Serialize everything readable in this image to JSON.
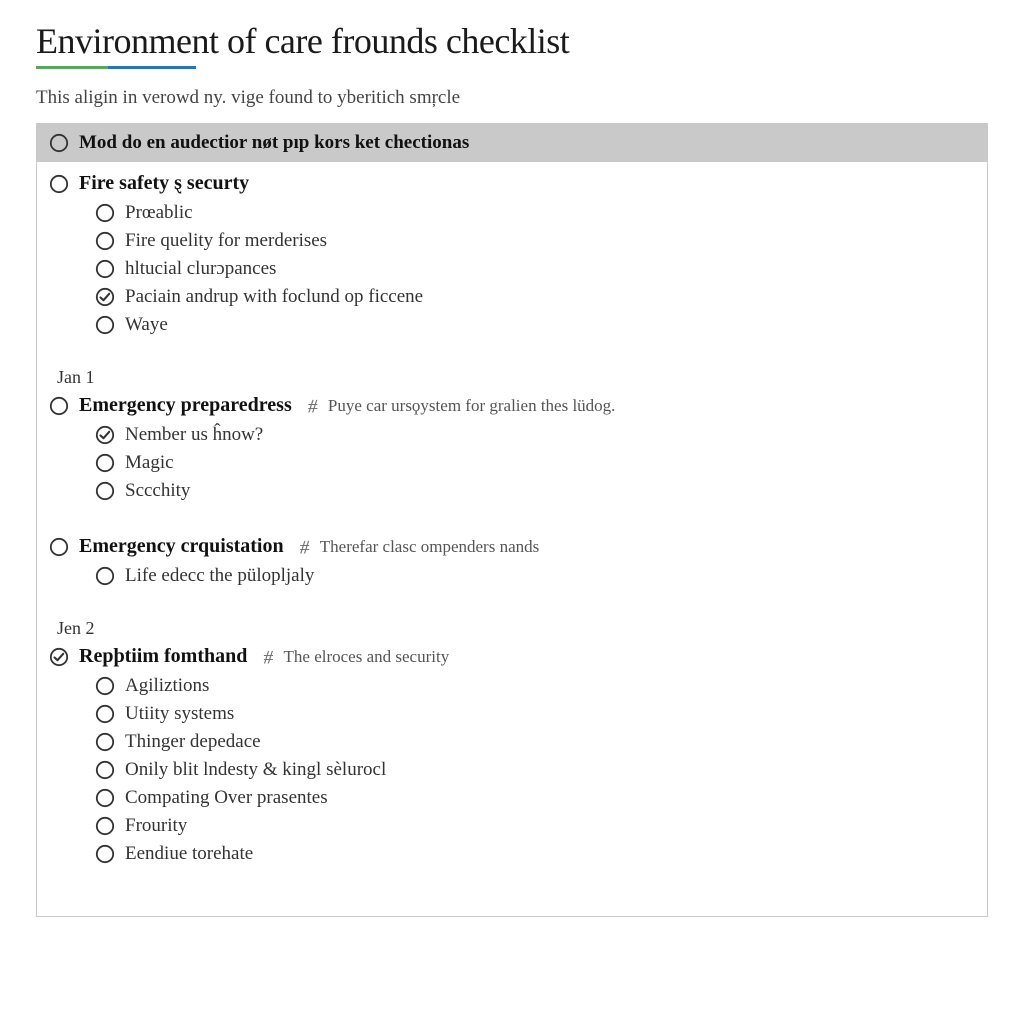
{
  "header": {
    "title": "Environment of care frounds checklist",
    "subtitle": "This aligin in verowd ny. vige found to yberitich smŗcle"
  },
  "panel": {
    "header_label": "Mod do en audectior nøt pıp kors ket chectionas",
    "header_checked": false
  },
  "sections": [
    {
      "date": "",
      "title": "Fire safety ȿ securty",
      "note": "",
      "checked": false,
      "items": [
        {
          "label": "Prœablic",
          "checked": false
        },
        {
          "label": "Fire quelity for merderises",
          "checked": false
        },
        {
          "label": "hltucial clurɔpances",
          "checked": false
        },
        {
          "label": "Paciain andrup with foclund op ficcene",
          "checked": true
        },
        {
          "label": "Waye",
          "checked": false
        }
      ]
    },
    {
      "date": "Jan 1",
      "title": "Emergency preparedress",
      "note": "Puye car ursϙystem for gralien thes lüdog.",
      "checked": false,
      "items": [
        {
          "label": "Nember us ĥnow?",
          "checked": true
        },
        {
          "label": "Magic",
          "checked": false
        },
        {
          "label": "Sccchity",
          "checked": false
        }
      ]
    },
    {
      "date": "",
      "title": "Emergency crquistation",
      "note": "Therefar clasc ompenders nands",
      "checked": false,
      "items": [
        {
          "label": "Life edecc the pülopljaly",
          "checked": false
        }
      ]
    },
    {
      "date": "Jen 2",
      "title": "Repþtiim fomthand",
      "note": "The elroces and security",
      "checked": true,
      "items": [
        {
          "label": "Agiliztions",
          "checked": false
        },
        {
          "label": "Utiity systems",
          "checked": false
        },
        {
          "label": "Thinger depedace",
          "checked": false
        },
        {
          "label": "Onily blit lndesty & kingl sèlurocl",
          "checked": false
        },
        {
          "label": "Compating Over prasentes",
          "checked": false
        },
        {
          "label": "Frourity",
          "checked": false
        },
        {
          "label": "Eendiue torehate",
          "checked": false
        }
      ]
    }
  ]
}
